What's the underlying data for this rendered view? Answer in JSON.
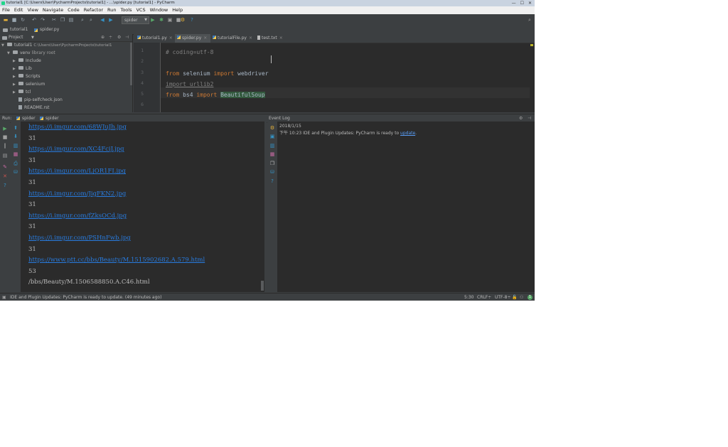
{
  "window": {
    "title": "tutorial1 [C:\\Users\\User\\PycharmProjects\\tutorial1] - ...\\spider.py [tutorial1] - PyCharm",
    "controls": [
      "—",
      "☐",
      "✕"
    ]
  },
  "menu": [
    "File",
    "Edit",
    "View",
    "Navigate",
    "Code",
    "Refactor",
    "Run",
    "Tools",
    "VCS",
    "Window",
    "Help"
  ],
  "toolbar": {
    "run_config": "spider"
  },
  "nav": {
    "project": "tutorial1",
    "file": "spider.py"
  },
  "project_panel": {
    "header": "Project",
    "tree": [
      {
        "label": "tutorial1",
        "suffix": "C:\\Users\\User\\PycharmProjects\\tutorial1",
        "kind": "folder",
        "expanded": true
      },
      {
        "label": "venv",
        "suffix": "library root",
        "kind": "folder",
        "expanded": true
      },
      {
        "label": "Include",
        "kind": "folder"
      },
      {
        "label": "Lib",
        "kind": "folder"
      },
      {
        "label": "Scripts",
        "kind": "folder"
      },
      {
        "label": "selenium",
        "kind": "folder"
      },
      {
        "label": "tcl",
        "kind": "folder"
      },
      {
        "label": "pip-selfcheck.json",
        "kind": "file"
      },
      {
        "label": "README.rst",
        "kind": "file"
      }
    ]
  },
  "editor": {
    "tabs": [
      {
        "label": "tutorial1.py",
        "active": false
      },
      {
        "label": "spider.py",
        "active": true
      },
      {
        "label": "tutorialFile.py",
        "active": false
      },
      {
        "label": "test.txt",
        "active": false
      }
    ],
    "lines": [
      {
        "n": "1",
        "parts": [
          {
            "t": "# coding=utf-8",
            "c": "cm"
          }
        ]
      },
      {
        "n": "2",
        "parts": []
      },
      {
        "n": "3",
        "parts": [
          {
            "t": "from ",
            "c": "kw"
          },
          {
            "t": "selenium ",
            "c": ""
          },
          {
            "t": "import ",
            "c": "kw"
          },
          {
            "t": "webdriver",
            "c": ""
          }
        ]
      },
      {
        "n": "4",
        "parts": [
          {
            "t": "import urllib2",
            "c": "unused"
          }
        ]
      },
      {
        "n": "5",
        "parts": [
          {
            "t": "from ",
            "c": "kw"
          },
          {
            "t": "bs4 ",
            "c": ""
          },
          {
            "t": "import ",
            "c": "kw"
          },
          {
            "t": "BeautifulSoup",
            "c": "hl"
          }
        ]
      },
      {
        "n": "6",
        "parts": []
      }
    ]
  },
  "run_panel": {
    "label": "Run:",
    "tabs": [
      "spider",
      "spider"
    ],
    "console": [
      {
        "text": "https://i.imgur.com/68WJuJh.jpg",
        "link": true
      },
      {
        "text": "31",
        "link": false
      },
      {
        "text": "https://i.imgur.com/XC4FciJ.jpg",
        "link": true
      },
      {
        "text": "31",
        "link": false
      },
      {
        "text": "https://i.imgur.com/LjOR1FI.jpg",
        "link": true
      },
      {
        "text": "31",
        "link": false
      },
      {
        "text": "https://i.imgur.com/JigFKN2.jpg",
        "link": true
      },
      {
        "text": "31",
        "link": false
      },
      {
        "text": "https://i.imgur.com/fZksOCd.jpg",
        "link": true
      },
      {
        "text": "31",
        "link": false
      },
      {
        "text": "https://i.imgur.com/PSHnFwb.jpg",
        "link": true
      },
      {
        "text": "31",
        "link": false
      },
      {
        "text": "https://www.ptt.cc/bbs/Beauty/M.1515902682.A.579.html",
        "link": true
      },
      {
        "text": "53",
        "link": false
      },
      {
        "text": "/bbs/Beauty/M.1506588850.A.C46.html",
        "link": false
      }
    ]
  },
  "event_log": {
    "title": "Event Log",
    "date": "2018/1/15",
    "time": "下午 10:23",
    "message_bold": "IDE and Plugin Updates:",
    "message": " PyCharm is ready to ",
    "link": "update",
    "message_end": "."
  },
  "statusbar": {
    "message": "IDE and Plugin Updates: PyCharm is ready to update. (49 minutes ago)",
    "position": "5:30",
    "line_sep": "CRLF÷",
    "encoding": "UTF-8÷"
  }
}
